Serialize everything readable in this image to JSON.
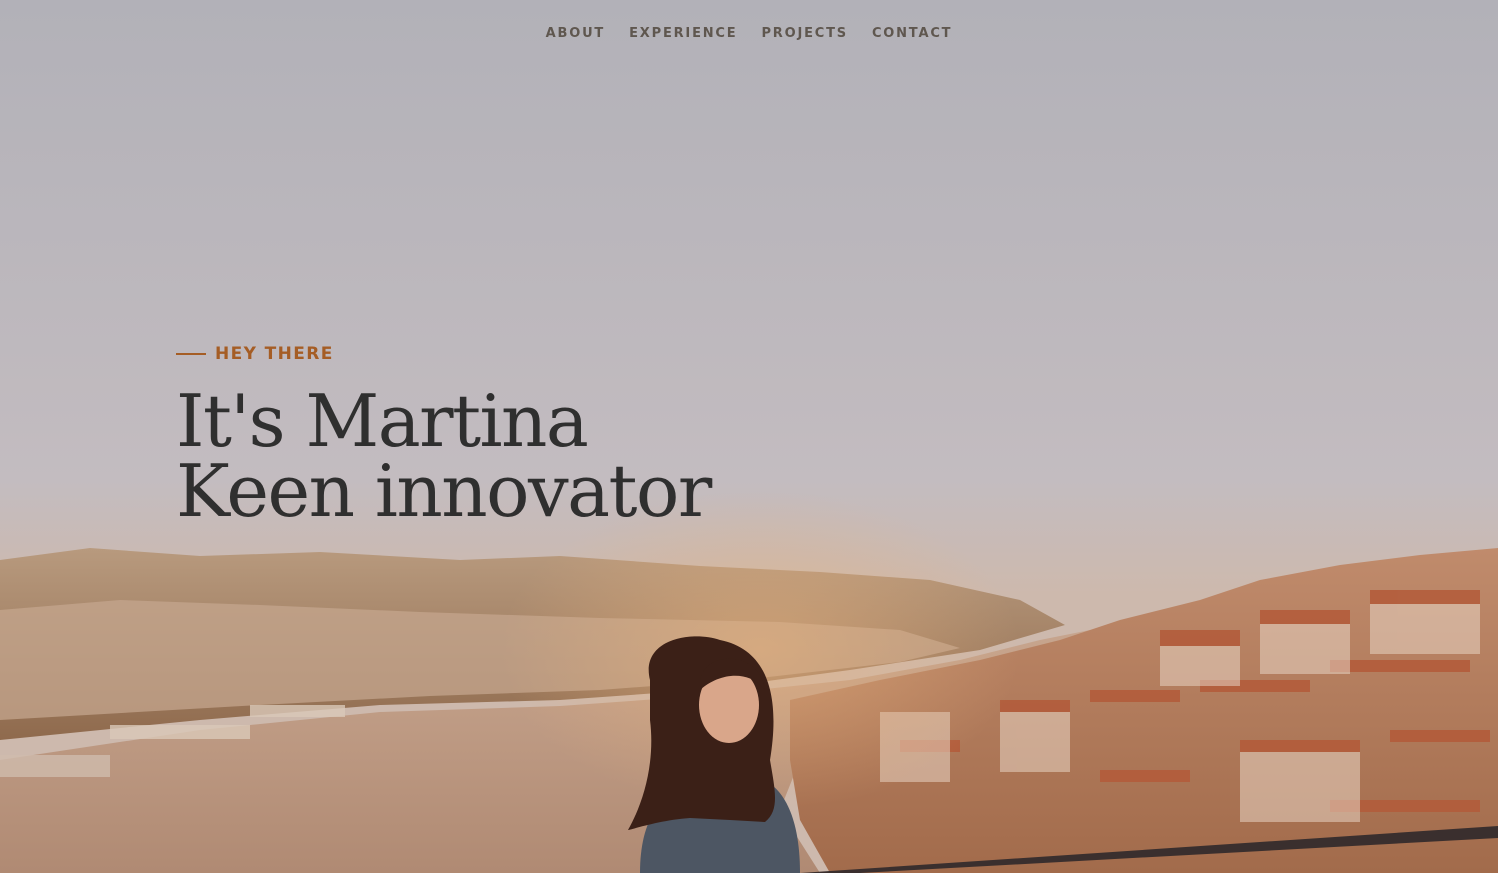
{
  "nav": {
    "items": [
      {
        "label": "ABOUT"
      },
      {
        "label": "EXPERIENCE"
      },
      {
        "label": "PROJECTS"
      },
      {
        "label": "CONTACT"
      }
    ]
  },
  "hero": {
    "eyebrow": "HEY THERE",
    "headline_line1": "It's Martina",
    "headline_line2": "Keen innovator",
    "accent_color": "#a55d25",
    "headline_color": "#2f2f2f",
    "nav_color": "#5f574f"
  }
}
